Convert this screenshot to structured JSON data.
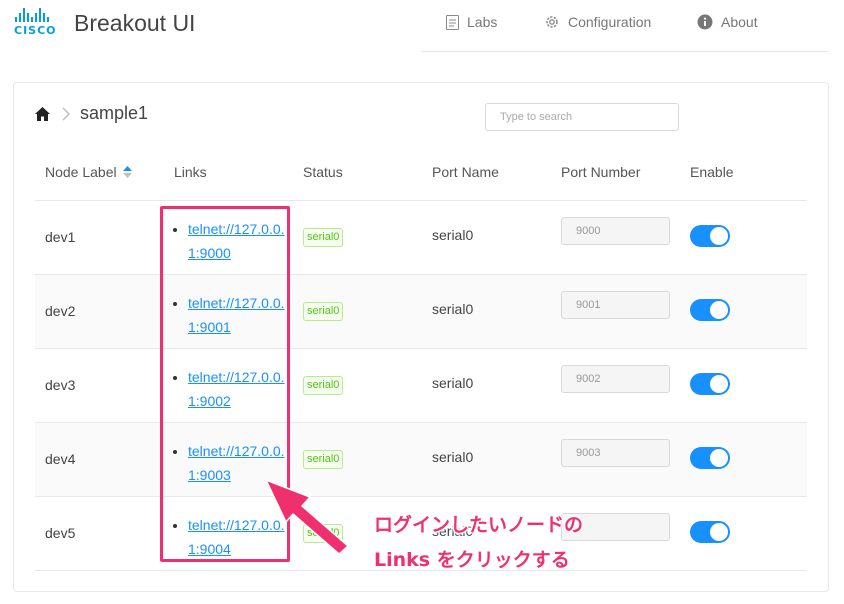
{
  "header": {
    "logo_word": "CISCO",
    "app_title": "Breakout UI",
    "nav": [
      {
        "label": "Labs",
        "icon": "document-icon"
      },
      {
        "label": "Configuration",
        "icon": "gear-icon"
      },
      {
        "label": "About",
        "icon": "info-icon"
      }
    ]
  },
  "breadcrumb": {
    "current": "sample1"
  },
  "search": {
    "placeholder": "Type to search"
  },
  "table": {
    "columns": [
      "Node Label",
      "Links",
      "Status",
      "Port Name",
      "Port Number",
      "Enable"
    ],
    "rows": [
      {
        "label": "dev1",
        "link": "telnet://127.0.0.1:9000",
        "status": "serial0",
        "port_name": "serial0",
        "port_number": "9000",
        "enabled": true
      },
      {
        "label": "dev2",
        "link": "telnet://127.0.0.1:9001",
        "status": "serial0",
        "port_name": "serial0",
        "port_number": "9001",
        "enabled": true
      },
      {
        "label": "dev3",
        "link": "telnet://127.0.0.1:9002",
        "status": "serial0",
        "port_name": "serial0",
        "port_number": "9002",
        "enabled": true
      },
      {
        "label": "dev4",
        "link": "telnet://127.0.0.1:9003",
        "status": "serial0",
        "port_name": "serial0",
        "port_number": "9003",
        "enabled": true
      },
      {
        "label": "dev5",
        "link": "telnet://127.0.0.1:9004",
        "status": "serial0",
        "port_name": "serial0",
        "port_number": "",
        "enabled": true
      }
    ]
  },
  "annotation": {
    "line1": "ログインしたいノードの",
    "line2": "Links をクリックする",
    "color": "#f0306e"
  },
  "colors": {
    "accent": "#1890ff",
    "brand": "#049fd9",
    "status_green": "#52c41a"
  }
}
